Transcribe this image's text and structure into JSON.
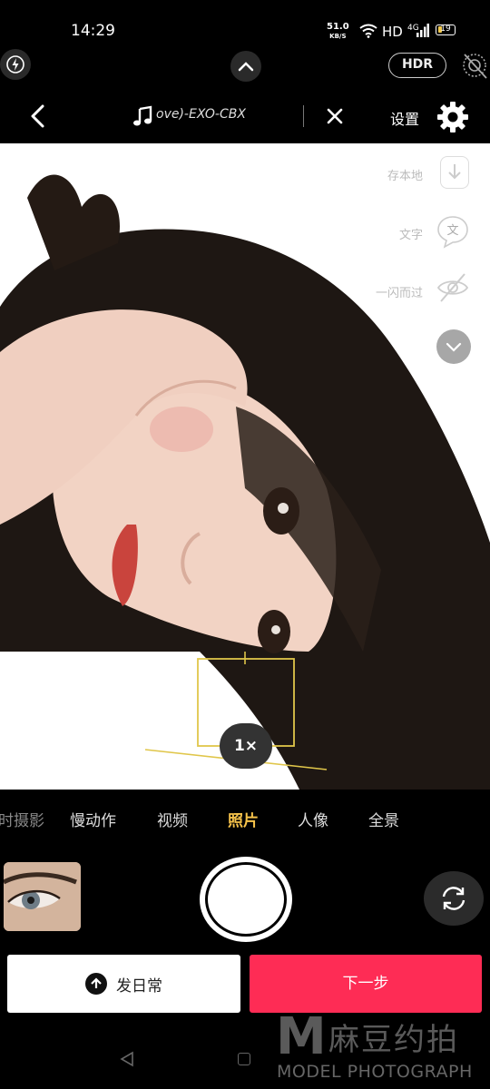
{
  "status_bar": {
    "time": "14:29",
    "network_speed": "51.0",
    "network_unit": "KB/S",
    "hd": "HD",
    "signal_type": "4G",
    "battery": "19"
  },
  "camera_controls": {
    "hdr_label": "HDR"
  },
  "top_bar": {
    "song": "ove)-EXO-CBX",
    "settings_label": "设置"
  },
  "side_tools": [
    {
      "label": "存本地",
      "icon": "download-icon"
    },
    {
      "label": "文字",
      "icon": "text-icon"
    },
    {
      "label": "一闪而过",
      "icon": "eye-off-icon"
    },
    {
      "label": "更多",
      "icon": "chevron-down-icon"
    }
  ],
  "zoom": "1×",
  "modes": [
    {
      "label": "时摄影",
      "active": false
    },
    {
      "label": "慢动作",
      "active": false
    },
    {
      "label": "视频",
      "active": false
    },
    {
      "label": "照片",
      "active": true
    },
    {
      "label": "人像",
      "active": false
    },
    {
      "label": "全景",
      "active": false
    }
  ],
  "actions": {
    "daily_label": "发日常",
    "next_label": "下一步"
  },
  "watermark": {
    "letter": "M",
    "chinese": "麻豆约拍",
    "english": "MODEL PHOTOGRAPH"
  },
  "colors": {
    "accent_yellow": "#f5c24a",
    "next_red": "#fe2c55"
  }
}
